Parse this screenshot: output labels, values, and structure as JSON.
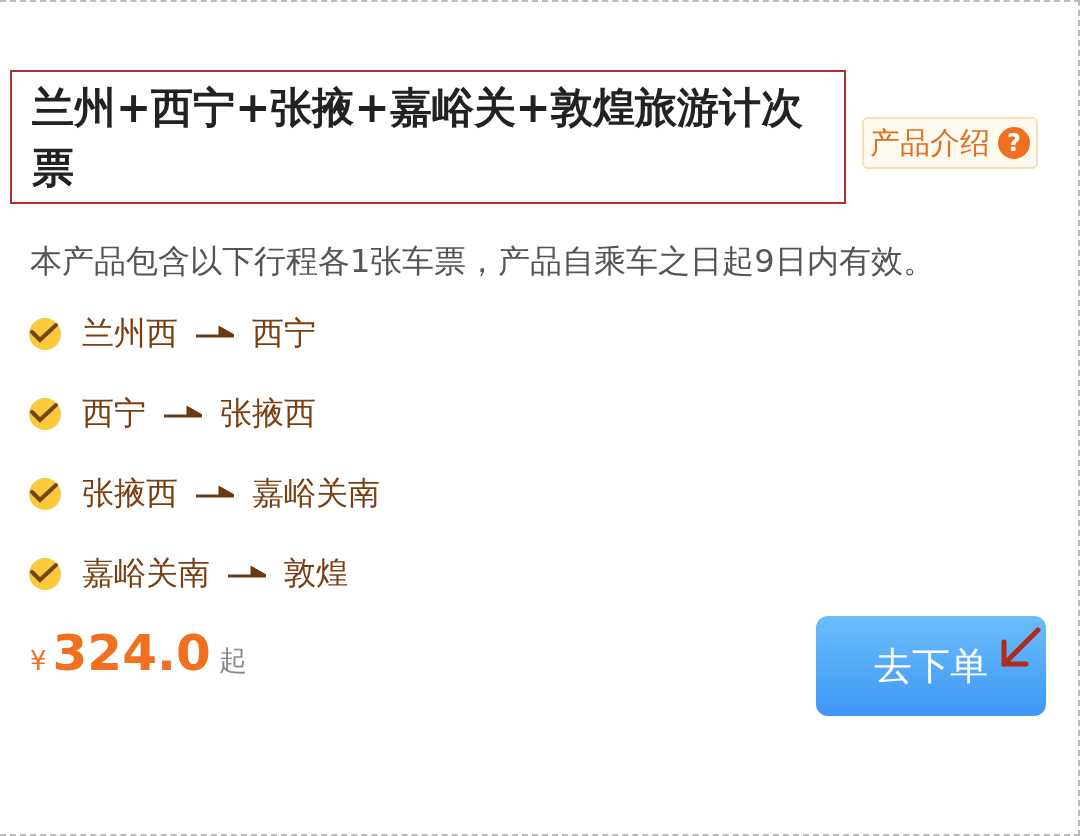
{
  "title": "兰州+西宁+张掖+嘉峪关+敦煌旅游计次票",
  "intro_badge": {
    "label": "产品介绍",
    "help": "?"
  },
  "description": "本产品包含以下行程各1张车票，产品自乘车之日起9日内有效。",
  "routes": [
    {
      "from": "兰州西",
      "to": "西宁"
    },
    {
      "from": "西宁",
      "to": "张掖西"
    },
    {
      "from": "张掖西",
      "to": "嘉峪关南"
    },
    {
      "from": "嘉峪关南",
      "to": "敦煌"
    }
  ],
  "price": {
    "currency": "¥",
    "amount": "324.0",
    "suffix": "起"
  },
  "order_button": "去下单"
}
